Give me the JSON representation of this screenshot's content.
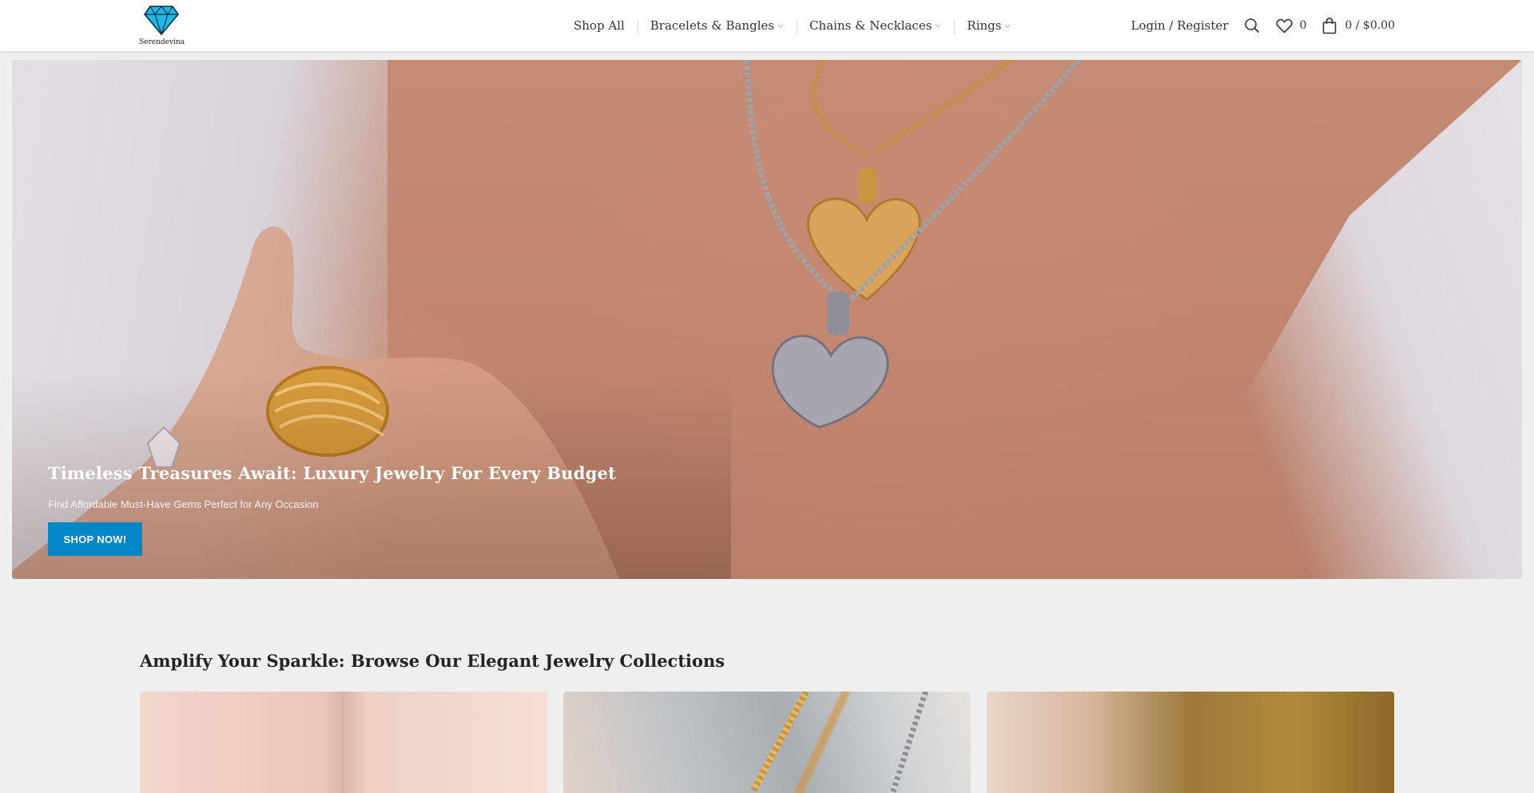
{
  "brand": {
    "name": "Serendevina",
    "logo_icon": "diamond-icon",
    "logo_color": "#1fb6e8"
  },
  "nav": {
    "items": [
      {
        "label": "Shop All",
        "has_dropdown": false
      },
      {
        "label": "Bracelets & Bangles",
        "has_dropdown": true
      },
      {
        "label": "Chains & Necklaces",
        "has_dropdown": true
      },
      {
        "label": "Rings",
        "has_dropdown": true
      }
    ]
  },
  "header_tools": {
    "login_label": "Login / Register",
    "search_icon": "search-icon",
    "wishlist_icon": "heart-icon",
    "wishlist_count": "0",
    "cart_icon": "shopping-bag-icon",
    "cart_summary": "0 / $0.00"
  },
  "hero": {
    "title": "Timeless Treasures Await: Luxury Jewelry For Every Budget",
    "subtitle": "Find Affordable Must-Have Gems Perfect for Any Occasion",
    "button_label": "SHOP NOW!",
    "button_color": "#0487c8"
  },
  "collections": {
    "title": "Amplify Your Sparkle: Browse Our Elegant Jewelry Collections"
  }
}
